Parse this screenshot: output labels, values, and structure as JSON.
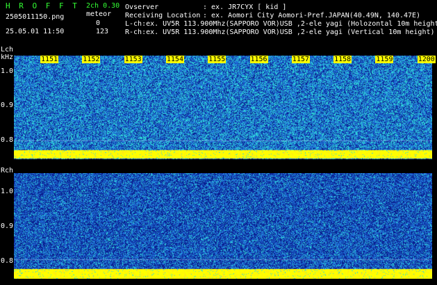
{
  "header": {
    "logo": "H R O F F T",
    "filename": "2505011150.png",
    "datetime": "25.05.01 11:50",
    "channel_label": "2ch 0.30",
    "meteor_label": "meteor",
    "lch_count": "0",
    "rch_count": "123",
    "observer_label": "Ovserver",
    "observer_value": ": ex. JR7CYX [ kid ]",
    "location_label": "Receiving Location",
    "location_value": ": ex. Aomori City Aomori-Pref.JAPAN(40.49N, 140.47E)",
    "lch_line": "L-ch:ex. UV5R 113.900Mhz(SAPPORO VOR)USB ,2-ele yagi (Holozontal 10m height",
    "rch_line": "R-ch:ex. UV5R 113.900Mhz(SAPPORO VOR)USB ,2-ele yagi (Vertical 10m height)"
  },
  "lch": {
    "label": "Lch",
    "unit": "kHz",
    "y_ticks": [
      "1.0",
      "0.9",
      "0.8"
    ]
  },
  "rch": {
    "label": "Rch",
    "y_ticks": [
      "1.0",
      "0.9",
      "0.8"
    ]
  },
  "time_axis": [
    "1151",
    "1152",
    "1153",
    "1154",
    "1155",
    "1156",
    "1157",
    "1158",
    "1159",
    "1200"
  ],
  "colors": {
    "background": "#000000",
    "noise_low": "#0a1f8f",
    "noise_mid": "#1f6fd6",
    "noise_high": "#2fd8d8",
    "carrier": "#ffff00",
    "text": "#ffffff",
    "logo": "#33ff33"
  }
}
